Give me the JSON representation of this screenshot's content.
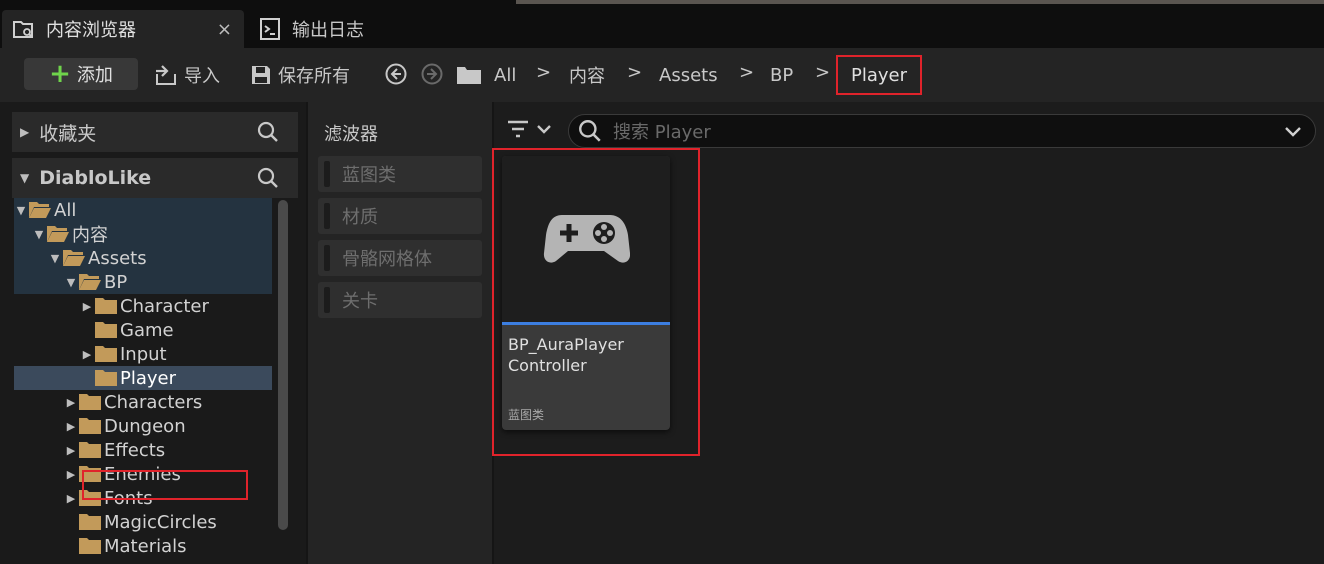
{
  "tabs": [
    {
      "label": "内容浏览器",
      "icon": "content-browser-icon",
      "close": "×"
    },
    {
      "label": "输出日志",
      "icon": "output-log-icon"
    }
  ],
  "toolbar": {
    "add_label": "添加",
    "import_label": "导入",
    "save_all_label": "保存所有"
  },
  "breadcrumb": {
    "items": [
      "All",
      "内容",
      "Assets",
      "BP"
    ],
    "current": "Player",
    "separator": ">"
  },
  "favorites": {
    "label": "收藏夹"
  },
  "project": {
    "label": "DiabloLike"
  },
  "tree": [
    {
      "label": "All",
      "arrow": "▼"
    },
    {
      "label": "内容",
      "arrow": "▼"
    },
    {
      "label": "Assets",
      "arrow": "▼"
    },
    {
      "label": "BP",
      "arrow": "▼"
    },
    {
      "label": "Character",
      "arrow": "▶"
    },
    {
      "label": "Game",
      "arrow": ""
    },
    {
      "label": "Input",
      "arrow": "▶"
    },
    {
      "label": "Player",
      "arrow": ""
    },
    {
      "label": "Characters",
      "arrow": "▶"
    },
    {
      "label": "Dungeon",
      "arrow": "▶"
    },
    {
      "label": "Effects",
      "arrow": "▶"
    },
    {
      "label": "Enemies",
      "arrow": "▶"
    },
    {
      "label": "Fonts",
      "arrow": "▶"
    },
    {
      "label": "MagicCircles",
      "arrow": ""
    },
    {
      "label": "Materials",
      "arrow": ""
    }
  ],
  "filters": {
    "title": "滤波器",
    "items": [
      "蓝图类",
      "材质",
      "骨骼网格体",
      "关卡"
    ]
  },
  "search": {
    "placeholder": "搜索 Player"
  },
  "asset": {
    "name": "BP_AuraPlayer Controller",
    "type": "蓝图类",
    "icon": "gamepad-icon"
  },
  "colors": {
    "accent": "#3c7ee0",
    "highlight_box": "#e0232b",
    "folder": "#c29a5a",
    "add_plus": "#6fd44b"
  }
}
